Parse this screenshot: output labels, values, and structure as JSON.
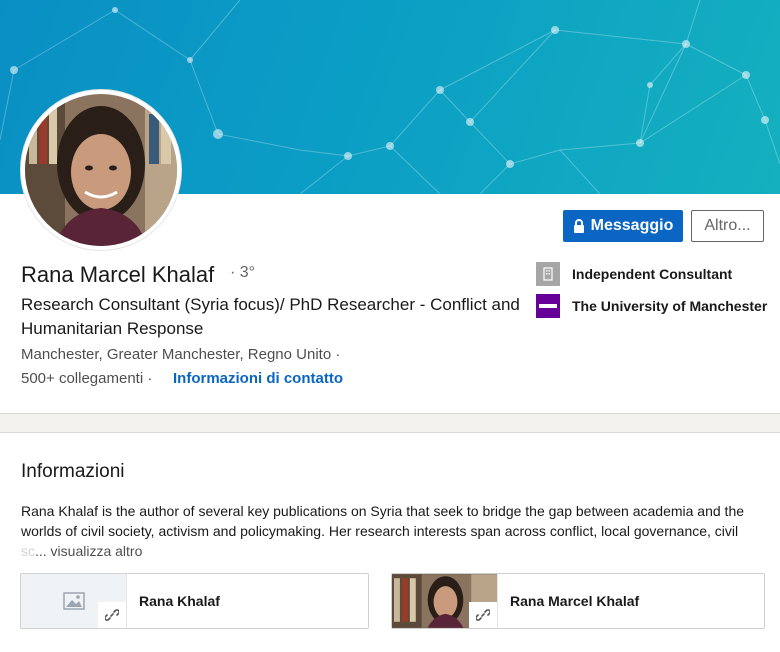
{
  "profile": {
    "name": "Rana Marcel Khalaf",
    "degree": "· 3°",
    "headline": "Research Consultant (Syria focus)/ PhD Researcher - Conflict and Humanitarian Response",
    "location": "Manchester, Greater Manchester, Regno Unito ·",
    "connections": "500+ collegamenti ·",
    "contact_link": "Informazioni di contatto",
    "avatar_icon": "profile-photo"
  },
  "actions": {
    "message_label": "Messaggio",
    "more_label": "Altro..."
  },
  "organizations": [
    {
      "name": "Independent Consultant",
      "logo_icon": "building-icon",
      "color": "#a6a6a6"
    },
    {
      "name": "The University of Manchester",
      "logo_icon": "university-logo",
      "color": "#660099"
    }
  ],
  "about": {
    "title": "Informazioni",
    "text": "Rana Khalaf is the author of several key publications on Syria that seek to bridge the gap between academia and the worlds of civil society, activism and policymaking. Her research interests span across conflict, local governance, civil",
    "faded": "sc",
    "more_label": "... visualizza altro",
    "media": [
      {
        "label": "Rana Khalaf",
        "thumb_icon": "image-placeholder-icon"
      },
      {
        "label": "Rana Marcel Khalaf",
        "thumb_icon": "profile-photo"
      }
    ]
  },
  "colors": {
    "brand": "#0a66c2",
    "banner_start": "#0a8fc4",
    "banner_end": "#14b0bf"
  }
}
